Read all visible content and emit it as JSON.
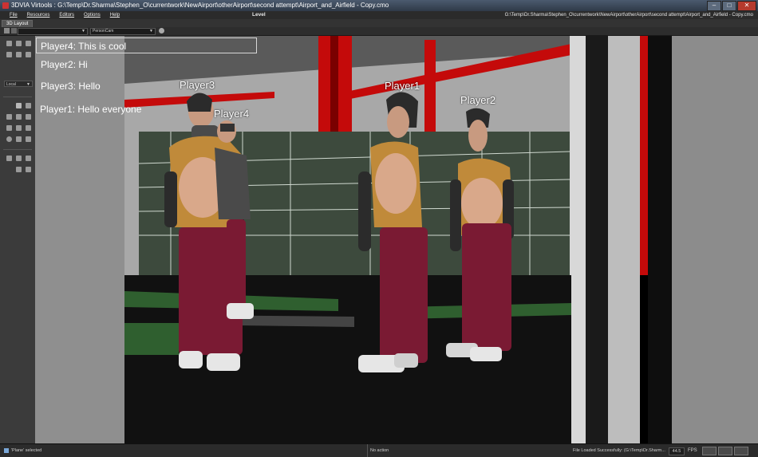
{
  "window": {
    "title": "3DVIA Virtools : G:\\Temp\\Dr.Sharma\\Stephen_O\\currentwork\\NewAirport\\otherAirport\\second attempt\\Airport_and_Airfield - Copy.cmo",
    "min_label": "–",
    "max_label": "□",
    "close_label": "✕"
  },
  "menu": {
    "items": [
      "File",
      "Resources",
      "Editors",
      "Options",
      "Help"
    ],
    "center_label": "Level",
    "path": "G:\\Temp\\Dr.Sharma\\Stephen_O\\currentwork\\NewAirport\\otherAirport\\second attempt\\Airport_and_Airfield - Copy.cmo"
  },
  "layout_tab": "3D Layout",
  "toolbar": {
    "camera_combo": "PersonCam"
  },
  "left_panel": {
    "coord_mode": "Local"
  },
  "chat": {
    "lines": [
      "Player4: This is cool",
      "Player2: Hi",
      "Player3: Hello",
      "Player1:  Hello everyone"
    ]
  },
  "players": {
    "p3": "Player3",
    "p4": "Player4",
    "p1": "Player1",
    "p2": "Player2"
  },
  "status": {
    "selection": "'Plane' selected",
    "action": "No action",
    "load_message": "File Loaded Successfully: (G:\\Temp\\Dr.Sharm...",
    "fps_value": "44.5",
    "fps_label": "FPS"
  },
  "colors": {
    "accent_red": "#c40a0a",
    "floor_green": "#2f5f2f",
    "shirt": "#c08a3a",
    "pants": "#7a1a33"
  }
}
